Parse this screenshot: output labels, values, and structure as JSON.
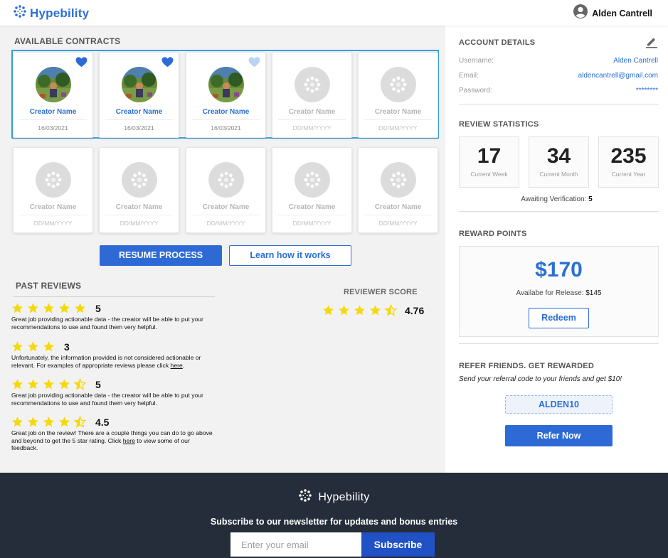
{
  "header": {
    "logo_text": "Hypebility",
    "user_name": "Alden Cantrell"
  },
  "contracts": {
    "title": "AVAILABLE CONTRACTS",
    "featured": [
      {
        "creator": "Creator Name",
        "date": "16/03/2021",
        "has_avatar": true,
        "favorited": true
      },
      {
        "creator": "Creator Name",
        "date": "16/03/2021",
        "has_avatar": true,
        "favorited": true
      },
      {
        "creator": "Creator Name",
        "date": "16/03/2021",
        "has_avatar": true,
        "favorited": false
      },
      {
        "creator": "Creator Name",
        "date": "DD/MM/YYYY",
        "has_avatar": false
      },
      {
        "creator": "Creator Name",
        "date": "DD/MM/YYYY",
        "has_avatar": false
      }
    ],
    "more": [
      {
        "creator": "Creator Name",
        "date": "DD/MM/YYYY"
      },
      {
        "creator": "Creator Name",
        "date": "DD/MM/YYYY"
      },
      {
        "creator": "Creator Name",
        "date": "DD/MM/YYYY"
      },
      {
        "creator": "Creator Name",
        "date": "DD/MM/YYYY"
      },
      {
        "creator": "Creator Name",
        "date": "DD/MM/YYYY"
      }
    ],
    "resume_label": "RESUME PROCESS",
    "learn_label": "Learn how it works"
  },
  "past_reviews": {
    "title": "PAST REVIEWS",
    "items": [
      {
        "rating": 5,
        "rating_label": "5",
        "text_before": "Great job providing actionable data - the creator will be able to put your recommendations to use and found them very helpful.",
        "link": "",
        "text_after": ""
      },
      {
        "rating": 3,
        "rating_label": "3",
        "text_before": "Unfortunately, the information provided is not considered actionable or relevant. For examples of appropriate reviews please click ",
        "link": "here",
        "text_after": "."
      },
      {
        "rating": 4.5,
        "rating_label": "5",
        "text_before": "Great job providing actionable data - the creator will be able to put your recommendations to use and found them very helpful.",
        "link": "",
        "text_after": ""
      },
      {
        "rating": 4.5,
        "rating_label": "4.5",
        "text_before": "Great job on the review! There are a couple things you can do to go above and beyond to get the 5 star rating. Click ",
        "link": "here",
        "text_after": " to view some of our feedback."
      }
    ]
  },
  "reviewer_score": {
    "title": "REVIEWER SCORE",
    "rating": 4.5,
    "value": "4.76"
  },
  "account": {
    "title": "ACCOUNT DETAILS",
    "username_label": "Username:",
    "username": "Alden Cantrell",
    "email_label": "Email:",
    "email": "aldencantrell@gmail.com",
    "password_label": "Password:",
    "password": "********"
  },
  "stats": {
    "title": "REVIEW STATISTICS",
    "items": [
      {
        "value": "17",
        "label": "Current Week"
      },
      {
        "value": "34",
        "label": "Current Month"
      },
      {
        "value": "235",
        "label": "Current Year"
      }
    ],
    "awaiting_label": "Awaiting Verification:",
    "awaiting_value": "5"
  },
  "reward": {
    "title": "REWARD POINTS",
    "amount": "$170",
    "available_label": "Availabe for Release:",
    "available_value": "$145",
    "redeem_label": "Redeem"
  },
  "refer": {
    "title": "REFER FRIENDS. GET REWARDED",
    "text": "Send your referral code to your friends and get $10!",
    "code": "ALDEN10",
    "button_label": "Refer Now"
  },
  "footer": {
    "logo_text": "Hypebility",
    "subscribe_text": "Subscribe to our newsletter for updates and bonus entries",
    "email_placeholder": "Enter your email",
    "subscribe_label": "Subscribe"
  },
  "colors": {
    "accent": "#2a6fd6",
    "star": "#f5d90a",
    "footer_bg": "#252c3a",
    "featured_border": "#3aa0e0"
  }
}
